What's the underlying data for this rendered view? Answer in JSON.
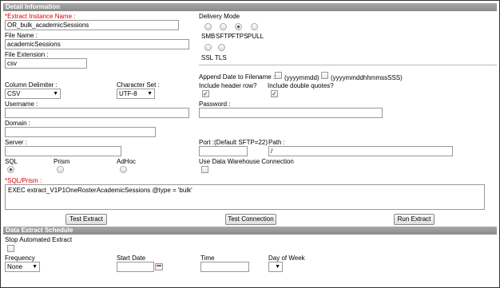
{
  "detail": {
    "header": "Detail Information",
    "instance_name_label": "*Extract Instance Name :",
    "instance_name_value": "OR_bulk_academicSessions",
    "file_name_label": "File Name :",
    "file_name_value": "academicSessions",
    "file_ext_label": "File Extension :",
    "file_ext_value": "csv",
    "delivery_mode_label": "Delivery Mode",
    "delivery_options": [
      "SMB",
      "SFTP",
      "FTPS",
      "PULL"
    ],
    "delivery_selected": "FTPS",
    "security_options": [
      "SSL",
      "TLS"
    ],
    "append_date_label": "Append Date to Filename :",
    "date_format_1": "(yyyymmdd)",
    "date_format_2": "(yyyymmddhhmmssSSS)",
    "include_header_label": "Include header row?",
    "include_quotes_label": "Include double quotes?",
    "include_header_checked": true,
    "include_quotes_checked": true,
    "column_delimiter_label": "Column Delimiter :",
    "column_delimiter_value": "CSV",
    "charset_label": "Character Set :",
    "charset_value": "UTF-8",
    "username_label": "Username :",
    "username_value": "",
    "password_label": "Password :",
    "password_value": "",
    "domain_label": "Domain :",
    "domain_value": "",
    "server_label": "Server :",
    "server_value": "",
    "port_label": "Port :(Default SFTP=22)",
    "port_value": "",
    "path_label": "Path :",
    "path_value": "/",
    "query_types": [
      "SQL",
      "Prism",
      "AdHoc"
    ],
    "query_type_selected": "SQL",
    "use_warehouse_label": "Use Data Warehouse Connection",
    "sql_label": "*SQL/Prism :",
    "sql_value": "EXEC extract_V1P1OneRosterAcademicSessions @type = 'bulk'",
    "test_extract_label": "Test Extract",
    "test_connection_label": "Test Connection",
    "run_extract_label": "Run Extract"
  },
  "schedule": {
    "header": "Data Extract Schedule",
    "stop_label": "Stop Automated Extract",
    "frequency_label": "Frequency",
    "frequency_value": "None",
    "start_date_label": "Start Date",
    "start_date_value": "",
    "time_label": "Time",
    "time_value": "",
    "day_of_week_label": "Day of Week",
    "day_of_week_value": ""
  }
}
